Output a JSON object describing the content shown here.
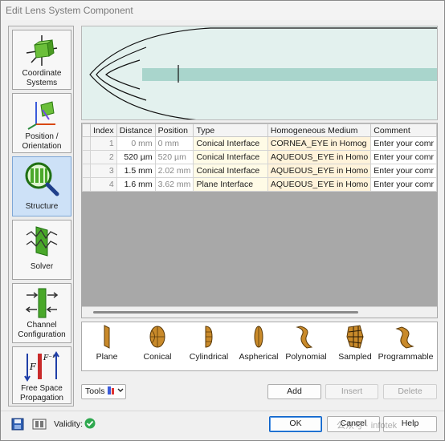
{
  "window": {
    "title": "Edit Lens System Component"
  },
  "nav": {
    "items": [
      {
        "label": "Coordinate Systems",
        "line1": "Coordinate",
        "line2": "Systems"
      },
      {
        "label": "Position / Orientation",
        "line1": "Position /",
        "line2": "Orientation"
      },
      {
        "label": "Structure",
        "line1": "Structure",
        "line2": ""
      },
      {
        "label": "Solver",
        "line1": "Solver",
        "line2": ""
      },
      {
        "label": "Channel Configuration",
        "line1": "Channel",
        "line2": "Configuration"
      },
      {
        "label": "Free Space Propagation",
        "line1": "Free Space",
        "line2": "Propagation"
      }
    ],
    "active": "Structure"
  },
  "table": {
    "columns": [
      "Index",
      "Distance",
      "Position",
      "Type",
      "Homogeneous Medium",
      "Comment"
    ],
    "rows": [
      {
        "index": "1",
        "distance": "0 mm",
        "position": "0 mm",
        "type": "Conical Interface",
        "medium": "CORNEA_EYE in Homog",
        "comment": "Enter your comr"
      },
      {
        "index": "2",
        "distance": "520 µm",
        "position": "520 µm",
        "type": "Conical Interface",
        "medium": "AQUEOUS_EYE in Homo",
        "comment": "Enter your comr"
      },
      {
        "index": "3",
        "distance": "1.5 mm",
        "position": "2.02 mm",
        "type": "Conical Interface",
        "medium": "AQUEOUS_EYE in Homo",
        "comment": "Enter your comr"
      },
      {
        "index": "4",
        "distance": "1.6 mm",
        "position": "3.62 mm",
        "type": "Plane Interface",
        "medium": "AQUEOUS_EYE in Homo",
        "comment": "Enter your comr"
      }
    ]
  },
  "palette": {
    "items": [
      "Plane",
      "Conical",
      "Cylindrical",
      "Aspherical",
      "Polynomial",
      "Sampled",
      "Programmable"
    ]
  },
  "actions": {
    "tools": "Tools",
    "add": "Add",
    "insert": "Insert",
    "delete": "Delete"
  },
  "footer": {
    "validity": "Validity:",
    "ok": "OK",
    "cancel": "Cancel",
    "help": "Help"
  },
  "watermark": {
    "text": "公众号 · infotek"
  },
  "colors": {
    "active_nav": "#cde1f7",
    "preview_bg": "#e3f1ee",
    "ray_band": "#a9d5cc",
    "type_cell": "#fffbe6",
    "medium_cell": "#fff3da",
    "valid_green": "#2fa84f",
    "primary_border": "#0b62c9"
  }
}
